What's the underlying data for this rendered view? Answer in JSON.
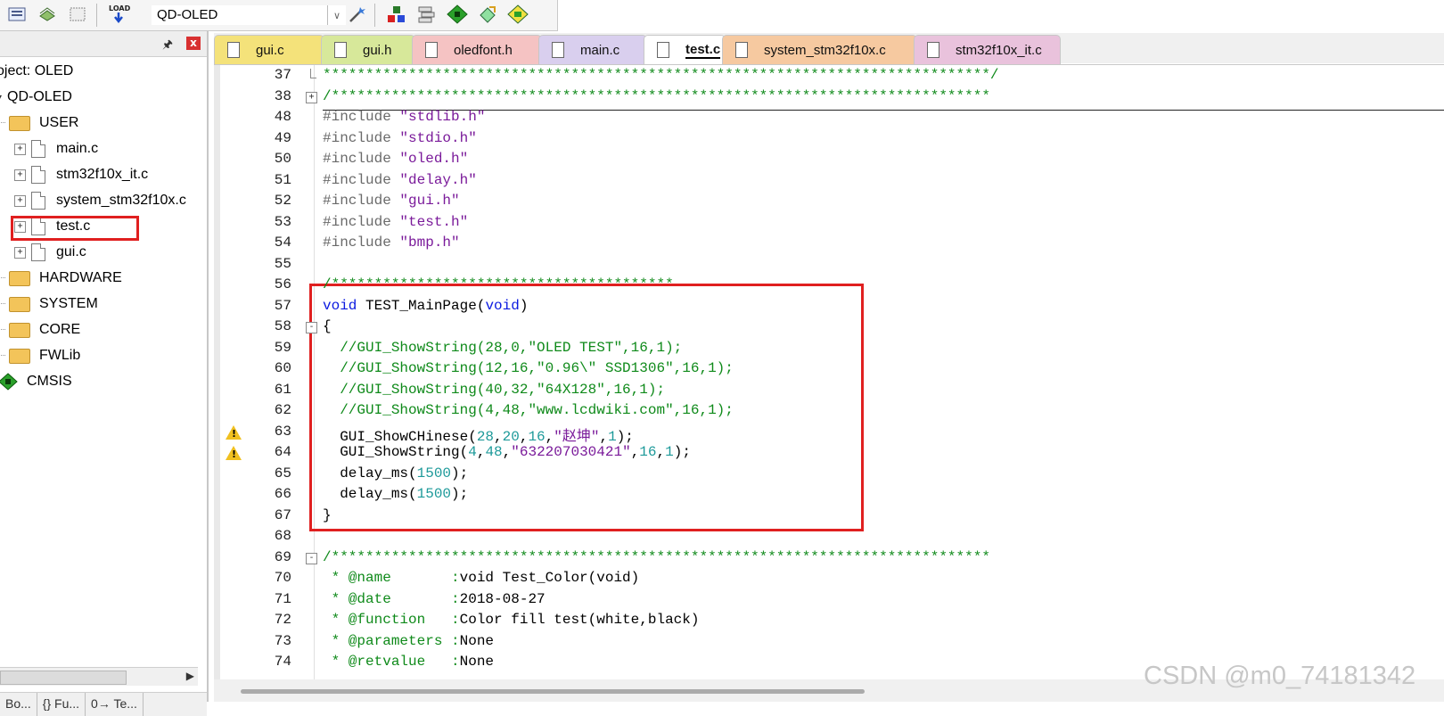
{
  "toolbar": {
    "target_value": "QD-OLED",
    "load_label": "LOAD",
    "icons": [
      "batch-build-icon",
      "rebuild-icon",
      "stop-build-icon",
      "download-icon",
      "options-wand-icon",
      "manage-components-icon",
      "stack-icon",
      "pack-installer-icon",
      "select-packs-icon",
      "runtime-env-icon"
    ]
  },
  "project_panel": {
    "pin_icon": "pin-icon",
    "close_label": "x",
    "tree": [
      {
        "label": "oject: OLED",
        "kind": "root",
        "indent": 0
      },
      {
        "label": "QD-OLED",
        "kind": "target",
        "indent": 1
      },
      {
        "label": "USER",
        "kind": "folder-open",
        "indent": 2
      },
      {
        "label": "main.c",
        "kind": "file",
        "indent": 3
      },
      {
        "label": "stm32f10x_it.c",
        "kind": "file",
        "indent": 3
      },
      {
        "label": "system_stm32f10x.c",
        "kind": "file",
        "indent": 3
      },
      {
        "label": "test.c",
        "kind": "file",
        "indent": 3,
        "highlighted": true
      },
      {
        "label": "gui.c",
        "kind": "file",
        "indent": 3
      },
      {
        "label": "HARDWARE",
        "kind": "folder",
        "indent": 2
      },
      {
        "label": "SYSTEM",
        "kind": "folder",
        "indent": 2
      },
      {
        "label": "CORE",
        "kind": "folder",
        "indent": 2
      },
      {
        "label": "FWLib",
        "kind": "folder",
        "indent": 2
      },
      {
        "label": "CMSIS",
        "kind": "component",
        "indent": 2
      }
    ],
    "bottom_tabs": [
      "Bo...",
      "{} Fu...",
      "0→ Te..."
    ]
  },
  "tabs": [
    {
      "label": "gui.c",
      "color": "#f4e27a",
      "active": false
    },
    {
      "label": "gui.h",
      "color": "#d7e89a",
      "active": false
    },
    {
      "label": "oledfont.h",
      "color": "#f5c3c3",
      "active": false
    },
    {
      "label": "main.c",
      "color": "#d9cfee",
      "active": false
    },
    {
      "label": "test.c",
      "color": "#ffffff",
      "active": true
    },
    {
      "label": "system_stm32f10x.c",
      "color": "#f6c9a0",
      "active": false
    },
    {
      "label": "stm32f10x_it.c",
      "color": "#e9c2dc",
      "active": false
    }
  ],
  "editor": {
    "lines": [
      {
        "n": "37",
        "fold": "end",
        "segs": [
          [
            "cm",
            "******************************************************************************/"
          ]
        ]
      },
      {
        "n": "38",
        "fold": "+",
        "segs": [
          [
            "cm",
            "/*****************************************************************************"
          ]
        ]
      },
      {
        "n": "48",
        "segs": [
          [
            "pp",
            "#include "
          ],
          [
            "str",
            "\"stdlib.h\""
          ]
        ]
      },
      {
        "n": "49",
        "segs": [
          [
            "pp",
            "#include "
          ],
          [
            "str",
            "\"stdio.h\""
          ]
        ]
      },
      {
        "n": "50",
        "segs": [
          [
            "pp",
            "#include "
          ],
          [
            "str",
            "\"oled.h\""
          ]
        ]
      },
      {
        "n": "51",
        "segs": [
          [
            "pp",
            "#include "
          ],
          [
            "str",
            "\"delay.h\""
          ]
        ]
      },
      {
        "n": "52",
        "segs": [
          [
            "pp",
            "#include "
          ],
          [
            "str",
            "\"gui.h\""
          ]
        ]
      },
      {
        "n": "53",
        "segs": [
          [
            "pp",
            "#include "
          ],
          [
            "str",
            "\"test.h\""
          ]
        ]
      },
      {
        "n": "54",
        "segs": [
          [
            "pp",
            "#include "
          ],
          [
            "str",
            "\"bmp.h\""
          ]
        ]
      },
      {
        "n": "55",
        "segs": []
      },
      {
        "n": "56",
        "segs": [
          [
            "cm",
            "/****************************************"
          ]
        ]
      },
      {
        "n": "57",
        "segs": [
          [
            "kw",
            "void"
          ],
          [
            "fn",
            " TEST_MainPage("
          ],
          [
            "kw",
            "void"
          ],
          [
            "fn",
            ")"
          ]
        ]
      },
      {
        "n": "58",
        "fold": "-",
        "segs": [
          [
            "fn",
            "{"
          ]
        ]
      },
      {
        "n": "59",
        "segs": [
          [
            "cm",
            "  //GUI_ShowString(28,0,\"OLED TEST\",16,1);"
          ]
        ]
      },
      {
        "n": "60",
        "segs": [
          [
            "cm",
            "  //GUI_ShowString(12,16,\"0.96\\\" SSD1306\",16,1);"
          ]
        ]
      },
      {
        "n": "61",
        "segs": [
          [
            "cm",
            "  //GUI_ShowString(40,32,\"64X128\",16,1);"
          ]
        ]
      },
      {
        "n": "62",
        "segs": [
          [
            "cm",
            "  //GUI_ShowString(4,48,\"www.lcdwiki.com\",16,1);"
          ]
        ]
      },
      {
        "n": "63",
        "warn": true,
        "segs": [
          [
            "fn",
            "  GUI_ShowCHinese("
          ],
          [
            "num",
            "28"
          ],
          [
            "fn",
            ","
          ],
          [
            "num",
            "20"
          ],
          [
            "fn",
            ","
          ],
          [
            "num",
            "16"
          ],
          [
            "fn",
            ","
          ],
          [
            "str",
            "\"赵坤\""
          ],
          [
            "fn",
            ","
          ],
          [
            "num",
            "1"
          ],
          [
            "fn",
            ");"
          ]
        ]
      },
      {
        "n": "64",
        "warn": true,
        "segs": [
          [
            "fn",
            "  GUI_ShowString("
          ],
          [
            "num",
            "4"
          ],
          [
            "fn",
            ","
          ],
          [
            "num",
            "48"
          ],
          [
            "fn",
            ","
          ],
          [
            "str",
            "\"632207030421\""
          ],
          [
            "fn",
            ","
          ],
          [
            "num",
            "16"
          ],
          [
            "fn",
            ","
          ],
          [
            "num",
            "1"
          ],
          [
            "fn",
            ");"
          ]
        ]
      },
      {
        "n": "65",
        "segs": [
          [
            "fn",
            "  delay_ms("
          ],
          [
            "num",
            "1500"
          ],
          [
            "fn",
            ");"
          ]
        ]
      },
      {
        "n": "66",
        "segs": [
          [
            "fn",
            "  delay_ms("
          ],
          [
            "num",
            "1500"
          ],
          [
            "fn",
            ");"
          ]
        ]
      },
      {
        "n": "67",
        "segs": [
          [
            "fn",
            "}"
          ]
        ]
      },
      {
        "n": "68",
        "segs": []
      },
      {
        "n": "69",
        "fold": "-",
        "segs": [
          [
            "cm",
            "/*****************************************************************************"
          ]
        ]
      },
      {
        "n": "70",
        "segs": [
          [
            "cm",
            " * @name       :"
          ],
          [
            "fn",
            "void Test_Color(void)"
          ]
        ]
      },
      {
        "n": "71",
        "segs": [
          [
            "cm",
            " * @date       :"
          ],
          [
            "fn",
            "2018-08-27"
          ]
        ]
      },
      {
        "n": "72",
        "segs": [
          [
            "cm",
            " * @function   :"
          ],
          [
            "fn",
            "Color fill test(white,black)"
          ]
        ]
      },
      {
        "n": "73",
        "segs": [
          [
            "cm",
            " * @parameters :"
          ],
          [
            "fn",
            "None"
          ]
        ]
      },
      {
        "n": "74",
        "segs": [
          [
            "cm",
            " * @retvalue   :"
          ],
          [
            "fn",
            "None"
          ]
        ]
      }
    ]
  },
  "watermark": "CSDN @m0_74181342"
}
